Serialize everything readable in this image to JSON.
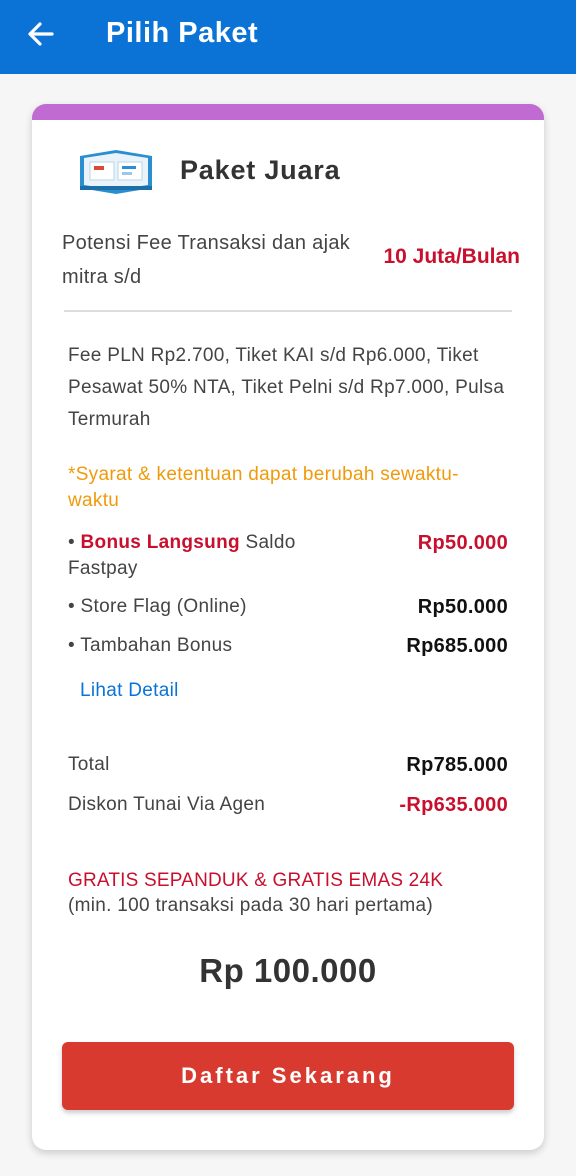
{
  "appbar": {
    "title": "Pilih Paket",
    "back_icon": "arrow-left-icon"
  },
  "colors": {
    "appbar": "#0b73d6",
    "card_accent": "#c06bd1",
    "red": "#c8102e",
    "orange": "#f09a0a",
    "button": "#d93a30",
    "link": "#0b73d6"
  },
  "package": {
    "name": "Paket Juara",
    "image_icon": "package-box-icon",
    "potensi_text": "Potensi Fee Transaksi dan ajak mitra s/d",
    "potensi_value": "10 Juta/Bulan",
    "fee_text": "Fee PLN Rp2.700, Tiket KAI s/d Rp6.000, Tiket Pesawat 50% NTA, Tiket Pelni s/d Rp7.000, Pulsa Termurah",
    "syarat": "*Syarat & ketentuan dapat berubah sewaktu-waktu",
    "bonus_rows": [
      {
        "bullet": "• ",
        "highlight": "Bonus Langsung",
        "label": " Saldo Fastpay",
        "value": "Rp50.000"
      },
      {
        "bullet": "• ",
        "highlight": "",
        "label": "Store Flag (Online)",
        "value": "Rp50.000"
      },
      {
        "bullet": "• ",
        "highlight": "",
        "label": "Tambahan Bonus",
        "value": "Rp685.000"
      }
    ],
    "lihat_detail": "Lihat Detail",
    "total_label": "Total",
    "total_value": "Rp785.000",
    "diskon_label": "Diskon Tunai Via Agen",
    "diskon_value": "-Rp635.000",
    "gratis": "GRATIS SEPANDUK & GRATIS EMAS 24K",
    "gratis_note": "(min. 100 transaksi pada 30 hari pertama)",
    "price": "Rp 100.000",
    "cta": "Daftar Sekarang"
  }
}
